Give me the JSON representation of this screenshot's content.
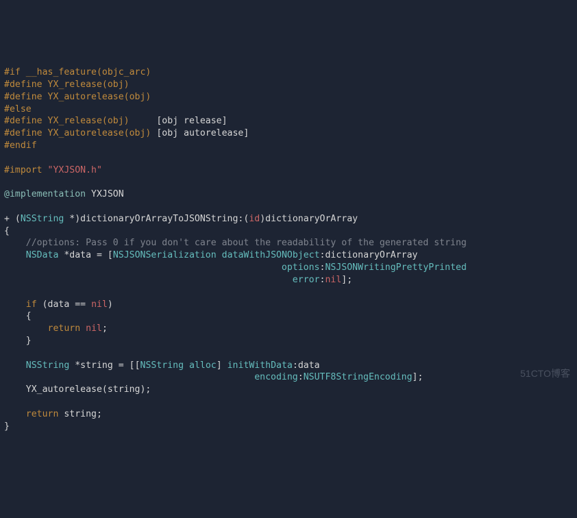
{
  "code": {
    "l00": {
      "a": "#if __has_feature(objc_arc)"
    },
    "l01": {
      "a": "#define YX_release(obj)"
    },
    "l02": {
      "a": "#define YX_autorelease(obj)"
    },
    "l03": {
      "a": "#else"
    },
    "l04": {
      "a": "#define YX_release(obj)     ",
      "b": "[obj release]"
    },
    "l05": {
      "a": "#define YX_autorelease(obj) ",
      "b": "[obj autorelease]"
    },
    "l06": {
      "a": "#endif"
    },
    "l07": {
      "a": ""
    },
    "l08": {
      "a": "#import ",
      "b": "\"YXJSON.h\""
    },
    "l09": {
      "a": ""
    },
    "l10": {
      "a": "@implementation",
      "b": " YXJSON"
    },
    "l11": {
      "a": ""
    },
    "l12": {
      "a": "+ (",
      "b": "NSString",
      "c": " *)dictionaryOrArrayToJSONString:(",
      "d": "id",
      "e": ")dictionaryOrArray"
    },
    "l13": {
      "a": "{"
    },
    "l14": {
      "a": "    ",
      "b": "//options: Pass 0 if you don't care about the readability of the generated string"
    },
    "l15": {
      "a": "    ",
      "b": "NSData",
      "c": " *data = [",
      "d": "NSJSONSerialization",
      "e": " ",
      "f": "dataWithJSONObject",
      "g": ":dictionaryOrArray"
    },
    "l16": {
      "a": "                                                   ",
      "b": "options",
      "c": ":",
      "d": "NSJSONWritingPrettyPrinted"
    },
    "l17": {
      "a": "                                                     ",
      "b": "error",
      "c": ":",
      "d": "nil",
      "e": "];"
    },
    "l18": {
      "a": ""
    },
    "l19": {
      "a": "    ",
      "b": "if",
      "c": " (data == ",
      "d": "nil",
      "e": ")"
    },
    "l20": {
      "a": "    {"
    },
    "l21": {
      "a": "        ",
      "b": "return",
      "c": " ",
      "d": "nil",
      "e": ";"
    },
    "l22": {
      "a": "    }"
    },
    "l23": {
      "a": ""
    },
    "l24": {
      "a": "    ",
      "b": "NSString",
      "c": " *string = [[",
      "d": "NSString",
      "e": " ",
      "f": "alloc",
      "g": "] ",
      "h": "initWithData",
      "i": ":data"
    },
    "l25": {
      "a": "                                              ",
      "b": "encoding",
      "c": ":",
      "d": "NSUTF8StringEncoding",
      "e": "];"
    },
    "l26": {
      "a": "    YX_autorelease(string);"
    },
    "l27": {
      "a": ""
    },
    "l28": {
      "a": "    ",
      "b": "return",
      "c": " string;"
    },
    "l29": {
      "a": "}"
    }
  },
  "watermark": "51CTO博客"
}
